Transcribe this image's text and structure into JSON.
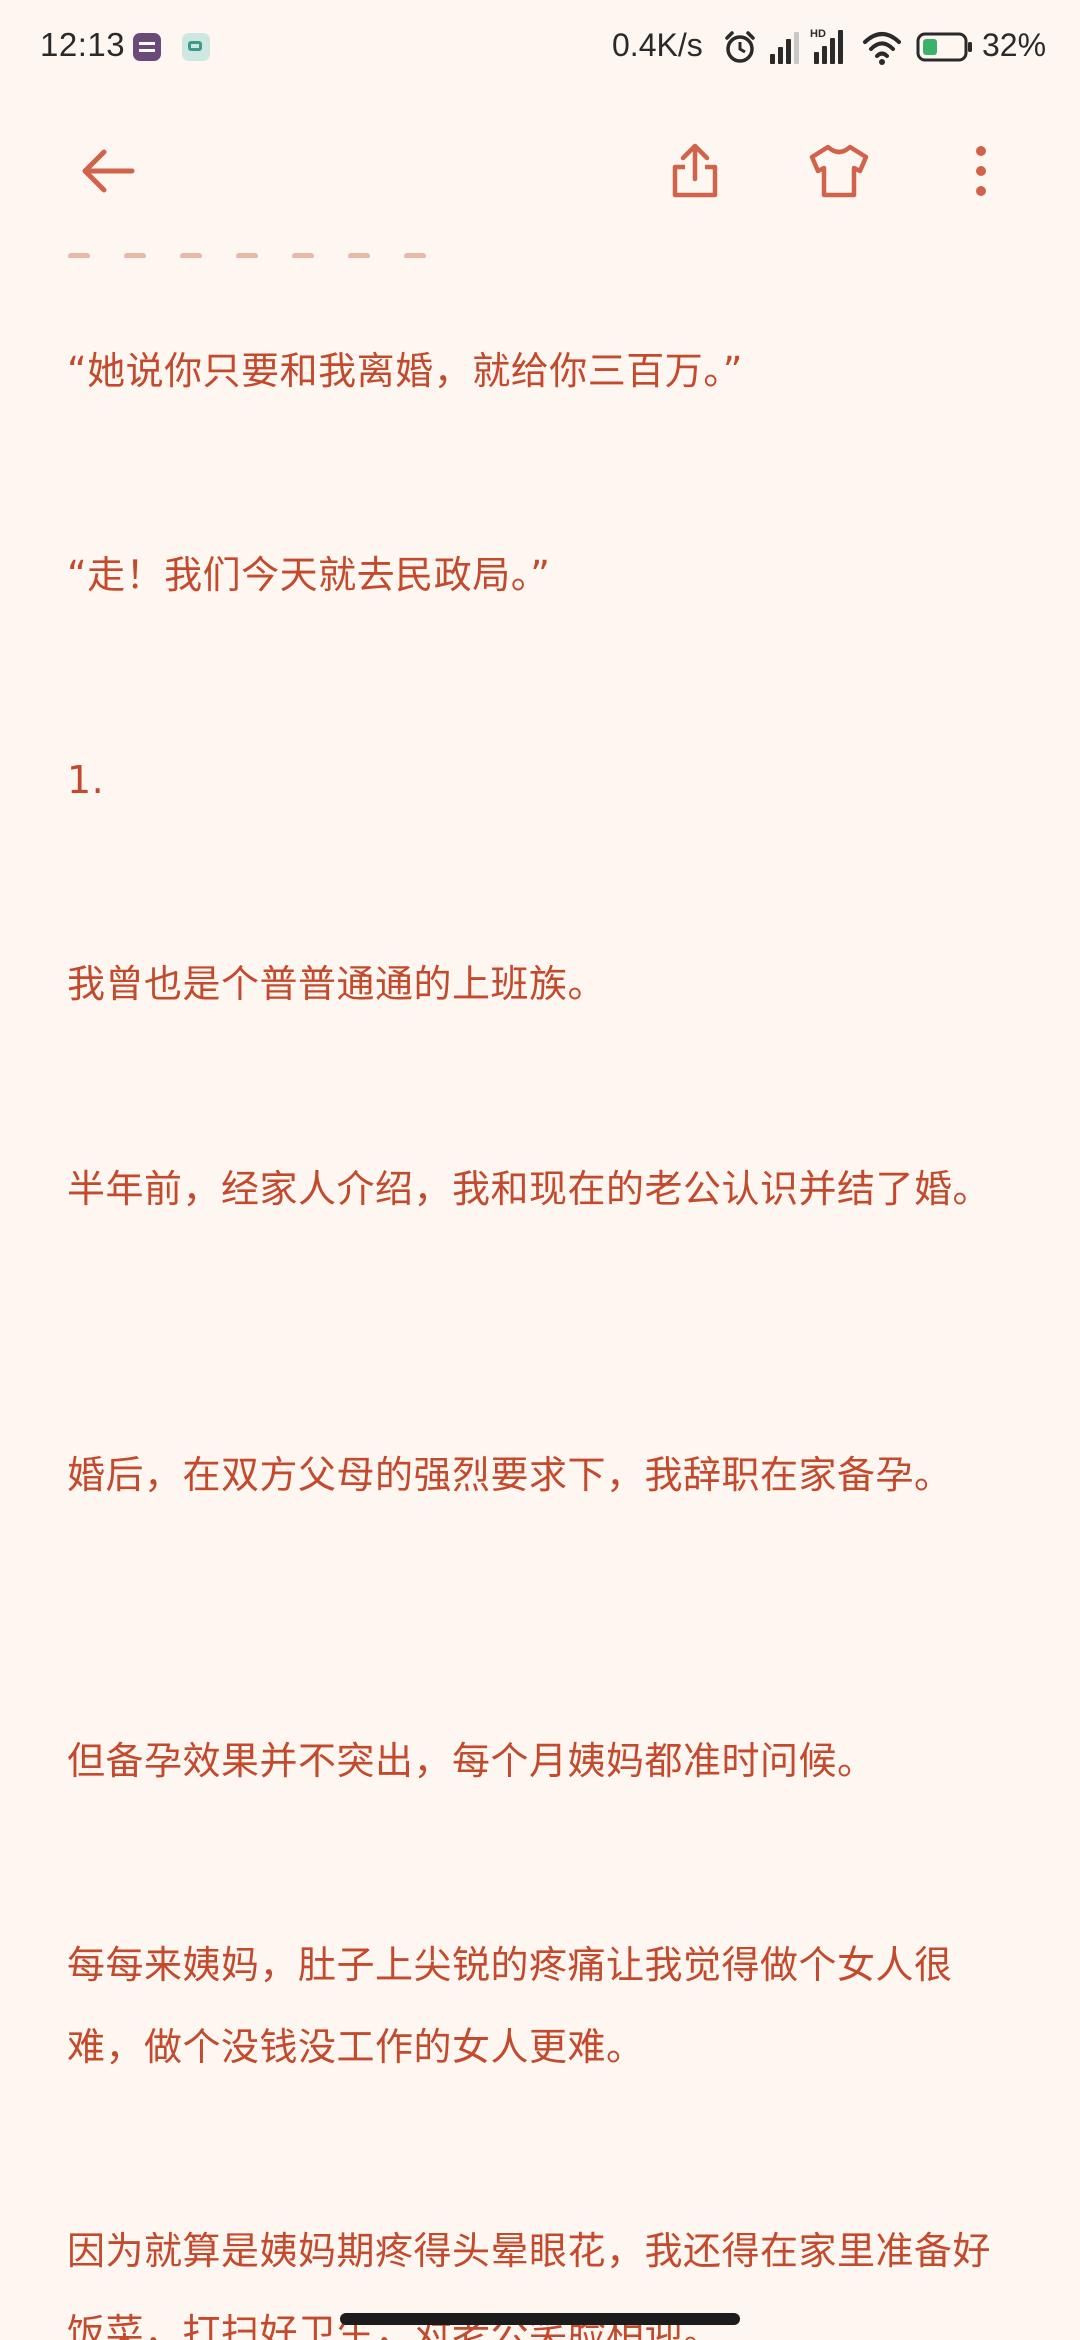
{
  "status_bar": {
    "time": "12:13",
    "network_speed": "0.4K/s",
    "battery_percent": "32%",
    "icons": [
      "app-notification-icon",
      "capcut-notification-icon",
      "alarm-icon",
      "signal-icon",
      "hd-signal-icon",
      "wifi-icon",
      "battery-icon"
    ]
  },
  "top_bar": {
    "icons": [
      "back-arrow-icon",
      "share-icon",
      "tshirt-theme-icon",
      "more-vertical-icon"
    ]
  },
  "reader": {
    "paragraphs": [
      "“她说你只要和我离婚，就给你三百万。”",
      "“走！我们今天就去民政局。”",
      "1.",
      "我曾也是个普普通通的上班族。",
      "半年前，经家人介绍，我和现在的老公认识并结了婚。",
      "婚后，在双方父母的强烈要求下，我辞职在家备孕。",
      "但备孕效果并不突出，每个月姨妈都准时问候。",
      "每每来姨妈，肚子上尖锐的疼痛让我觉得做个女人很难，做个没钱没工作的女人更难。",
      "因为就算是姨妈期疼得头晕眼花，我还得在家里准备好饭菜，打扫好卫生，对老公笑脸相迎。"
    ]
  },
  "colors": {
    "background": "#fdf6f1",
    "text": "#c34a2c",
    "icon": "#d0634a"
  }
}
